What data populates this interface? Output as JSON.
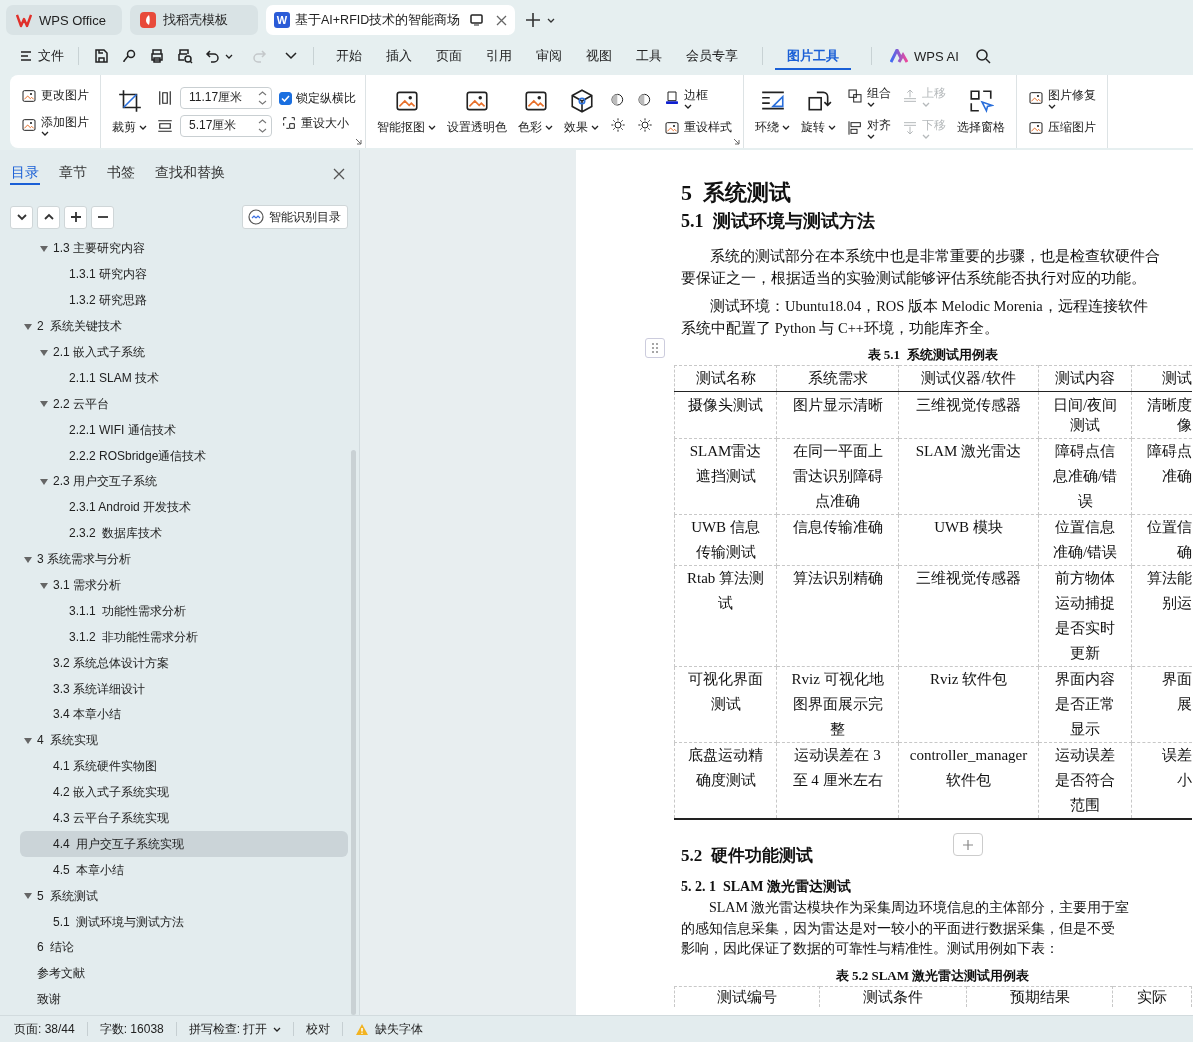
{
  "tabs": [
    {
      "label": "WPS Office",
      "selected": false
    },
    {
      "label": "找稻壳模板",
      "selected": false
    },
    {
      "label": "基于AI+RFID技术的智能商场",
      "badge": "W",
      "selected": true
    }
  ],
  "file_menu": "文件",
  "menu": [
    {
      "label": "开始",
      "selected": false
    },
    {
      "label": "插入",
      "selected": false
    },
    {
      "label": "页面",
      "selected": false
    },
    {
      "label": "引用",
      "selected": false
    },
    {
      "label": "审阅",
      "selected": false
    },
    {
      "label": "视图",
      "selected": false
    },
    {
      "label": "工具",
      "selected": false
    },
    {
      "label": "会员专享",
      "selected": false
    },
    {
      "label": "图片工具",
      "selected": true
    }
  ],
  "ai_button": "WPS AI",
  "ribbon": {
    "groups": [
      {
        "launcher": false,
        "columns": [
          [
            {
              "kind": "small",
              "label": "更改图片",
              "dropdown": false,
              "disabled": false
            },
            {
              "kind": "small",
              "label": "添加图片",
              "dropdown": true,
              "disabled": false
            }
          ]
        ]
      },
      {
        "launcher": true,
        "columns": [
          [
            {
              "kind": "large",
              "label": "裁剪",
              "dropdown": true,
              "disabled": false
            }
          ],
          [
            {
              "kind": "field",
              "value": "11.17厘米"
            },
            {
              "kind": "field",
              "value": "5.17厘米"
            }
          ],
          [
            {
              "kind": "checkbox",
              "label": "锁定纵横比",
              "checked": true
            },
            {
              "kind": "small",
              "label": "重设大小",
              "dropdown": false,
              "disabled": false
            }
          ]
        ]
      },
      {
        "launcher": true,
        "columns": [
          [
            {
              "kind": "large",
              "label": "智能抠图",
              "dropdown": true,
              "disabled": false
            }
          ],
          [
            {
              "kind": "large",
              "label": "设置透明色",
              "dropdown": false,
              "disabled": false
            }
          ],
          [
            {
              "kind": "large",
              "label": "色彩",
              "dropdown": true,
              "disabled": false
            }
          ],
          [
            {
              "kind": "large",
              "label": "效果",
              "dropdown": true,
              "disabled": false
            }
          ],
          [
            {
              "kind": "icon",
              "disabled": false
            },
            {
              "kind": "icon",
              "disabled": false
            }
          ],
          [
            {
              "kind": "icon",
              "disabled": false
            },
            {
              "kind": "icon",
              "disabled": false
            }
          ],
          [
            {
              "kind": "small",
              "label": "边框",
              "dropdown": true,
              "disabled": false
            },
            {
              "kind": "small",
              "label": "重设样式",
              "dropdown": false,
              "disabled": false
            }
          ]
        ]
      },
      {
        "launcher": false,
        "columns": [
          [
            {
              "kind": "large",
              "label": "环绕",
              "dropdown": true,
              "disabled": false
            }
          ],
          [
            {
              "kind": "large",
              "label": "旋转",
              "dropdown": true,
              "disabled": false
            }
          ],
          [
            {
              "kind": "small",
              "label": "组合",
              "dropdown": true,
              "disabled": false
            },
            {
              "kind": "small",
              "label": "对齐",
              "dropdown": true,
              "disabled": false
            }
          ],
          [
            {
              "kind": "small",
              "label": "上移",
              "dropdown": true,
              "disabled": true
            },
            {
              "kind": "small",
              "label": "下移",
              "dropdown": true,
              "disabled": true
            }
          ],
          [
            {
              "kind": "large",
              "label": "选择窗格",
              "dropdown": false,
              "disabled": false
            }
          ]
        ]
      },
      {
        "launcher": false,
        "columns": [
          [
            {
              "kind": "small",
              "label": "图片修复",
              "dropdown": true,
              "disabled": false
            },
            {
              "kind": "small",
              "label": "压缩图片",
              "dropdown": false,
              "disabled": false
            }
          ]
        ]
      }
    ]
  },
  "sidebar": {
    "tabs": [
      {
        "label": "目录",
        "selected": true
      },
      {
        "label": "章节",
        "selected": false
      },
      {
        "label": "书签",
        "selected": false
      },
      {
        "label": "查找和替换",
        "selected": false
      }
    ],
    "smart_toc_button": "智能识别目录",
    "toc": {
      "continued": [
        {
          "label": "1.3 主要研究内容",
          "expanded": true,
          "selected": false,
          "children": [
            {
              "label": "1.3.1 研究内容",
              "selected": false
            },
            {
              "label": "1.3.2 研究思路",
              "selected": false
            }
          ]
        }
      ],
      "items": [
        {
          "label": "2  系统关键技术",
          "expanded": true,
          "selected": false,
          "children": [
            {
              "label": "2.1 嵌入式子系统",
              "expanded": true,
              "selected": false,
              "children": [
                {
                  "label": "2.1.1 SLAM 技术",
                  "selected": false
                }
              ]
            },
            {
              "label": "2.2 云平台",
              "expanded": true,
              "selected": false,
              "children": [
                {
                  "label": "2.2.1 WIFI 通信技术",
                  "selected": false
                },
                {
                  "label": "2.2.2 ROSbridge通信技术",
                  "selected": false
                }
              ]
            },
            {
              "label": "2.3 用户交互子系统",
              "expanded": true,
              "selected": false,
              "children": [
                {
                  "label": "2.3.1 Android 开发技术",
                  "selected": false
                },
                {
                  "label": "2.3.2  数据库技术",
                  "selected": false
                }
              ]
            }
          ]
        },
        {
          "label": "3 系统需求与分析",
          "expanded": true,
          "selected": false,
          "children": [
            {
              "label": "3.1 需求分析",
              "expanded": true,
              "selected": false,
              "children": [
                {
                  "label": "3.1.1  功能性需求分析",
                  "selected": false
                },
                {
                  "label": "3.1.2  非功能性需求分析",
                  "selected": false
                }
              ]
            },
            {
              "label": "3.2 系统总体设计方案",
              "selected": false
            },
            {
              "label": "3.3 系统详细设计",
              "selected": false
            },
            {
              "label": "3.4 本章小结",
              "selected": false
            }
          ]
        },
        {
          "label": "4  系统实现",
          "expanded": true,
          "selected": false,
          "children": [
            {
              "label": "4.1 系统硬件实物图",
              "selected": false
            },
            {
              "label": "4.2 嵌入式子系统实现",
              "selected": false
            },
            {
              "label": "4.3 云平台子系统实现",
              "selected": false
            },
            {
              "label": "4.4  用户交互子系统实现",
              "selected": true
            },
            {
              "label": "4.5  本章小结",
              "selected": false
            }
          ]
        },
        {
          "label": "5  系统测试",
          "expanded": true,
          "selected": false,
          "children": [
            {
              "label": "5.1  测试环境与测试方法",
              "selected": false
            }
          ]
        },
        {
          "label": "6  结论",
          "selected": false
        },
        {
          "label": "参考文献",
          "selected": false
        },
        {
          "label": "致谢",
          "selected": false
        }
      ]
    }
  },
  "document": {
    "heading": "5  系统测试",
    "section": "5.1  测试环境与测试方法",
    "paragraphs": [
      [
        "系统的测试部分在本系统中也是非常重要的步骤，也是检查软硬件合",
        "要保证之一，根据适当的实验测试能够评估系统能否执行对应的功能。"
      ],
      [
        "测试环境：Ubuntu18.04，ROS 版本 Melodic Morenia，远程连接软件",
        "系统中配置了 Python 与 C++环境，功能库齐全。"
      ]
    ],
    "table_1": {
      "caption": "表 5.1  系统测试用例表",
      "columns": [
        "测试名称",
        "系统需求",
        "测试仪器/软件",
        "测试内容",
        "测试"
      ],
      "rows": [
        [
          "摄像头测试",
          "图片显示清晰",
          "三维视觉传感器",
          "日间/夜间测试",
          [
            "清晰度",
            "像"
          ]
        ],
        [
          "SLAM雷达遮挡测试",
          "在同一平面上雷达识别障碍点准确",
          "SLAM 激光雷达",
          "障碍点信息准确/错误",
          [
            "障碍点",
            "准确"
          ]
        ],
        [
          "UWB 信息传输测试",
          "信息传输准确",
          "UWB 模块",
          "位置信息准确/错误",
          [
            "位置信",
            "确"
          ]
        ],
        [
          "Rtab 算法测试",
          "算法识别精确",
          "三维视觉传感器",
          "前方物体运动捕捉是否实时更新",
          [
            "算法能",
            "别运"
          ]
        ],
        [
          "可视化界面测试",
          "Rviz 可视化地图界面展示完整",
          "Rviz 软件包",
          "界面内容是否正常显示",
          [
            "界面",
            "展"
          ]
        ],
        [
          "底盘运动精确度测试",
          "运动误差在 3 至 4 厘米左右",
          "controller_manager 软件包",
          "运动误差是否符合范围",
          [
            "误差",
            "小"
          ]
        ]
      ]
    },
    "section_2": "5.2  硬件功能测试",
    "subsection": "5. 2. 1  SLAM 激光雷达测试",
    "paragraph_3": [
      "SLAM 激光雷达模块作为采集周边环境信息的主体部分，主要用于室",
      "的感知信息采集，因为雷达是对一较小的平面进行数据采集，但是不受",
      "影响，因此保证了数据的可靠性与精准性。测试用例如下表："
    ],
    "table_2": {
      "caption": "表 5.2 SLAM 激光雷达测试用例表",
      "columns": [
        "测试编号",
        "测试条件",
        "预期结果",
        "实际"
      ]
    }
  },
  "status_bar": {
    "page": "页面: 38/44",
    "words": "字数: 16038",
    "spell_check": "拼写检查: 打开",
    "proofread": "校对",
    "missing_fonts": "缺失字体"
  }
}
